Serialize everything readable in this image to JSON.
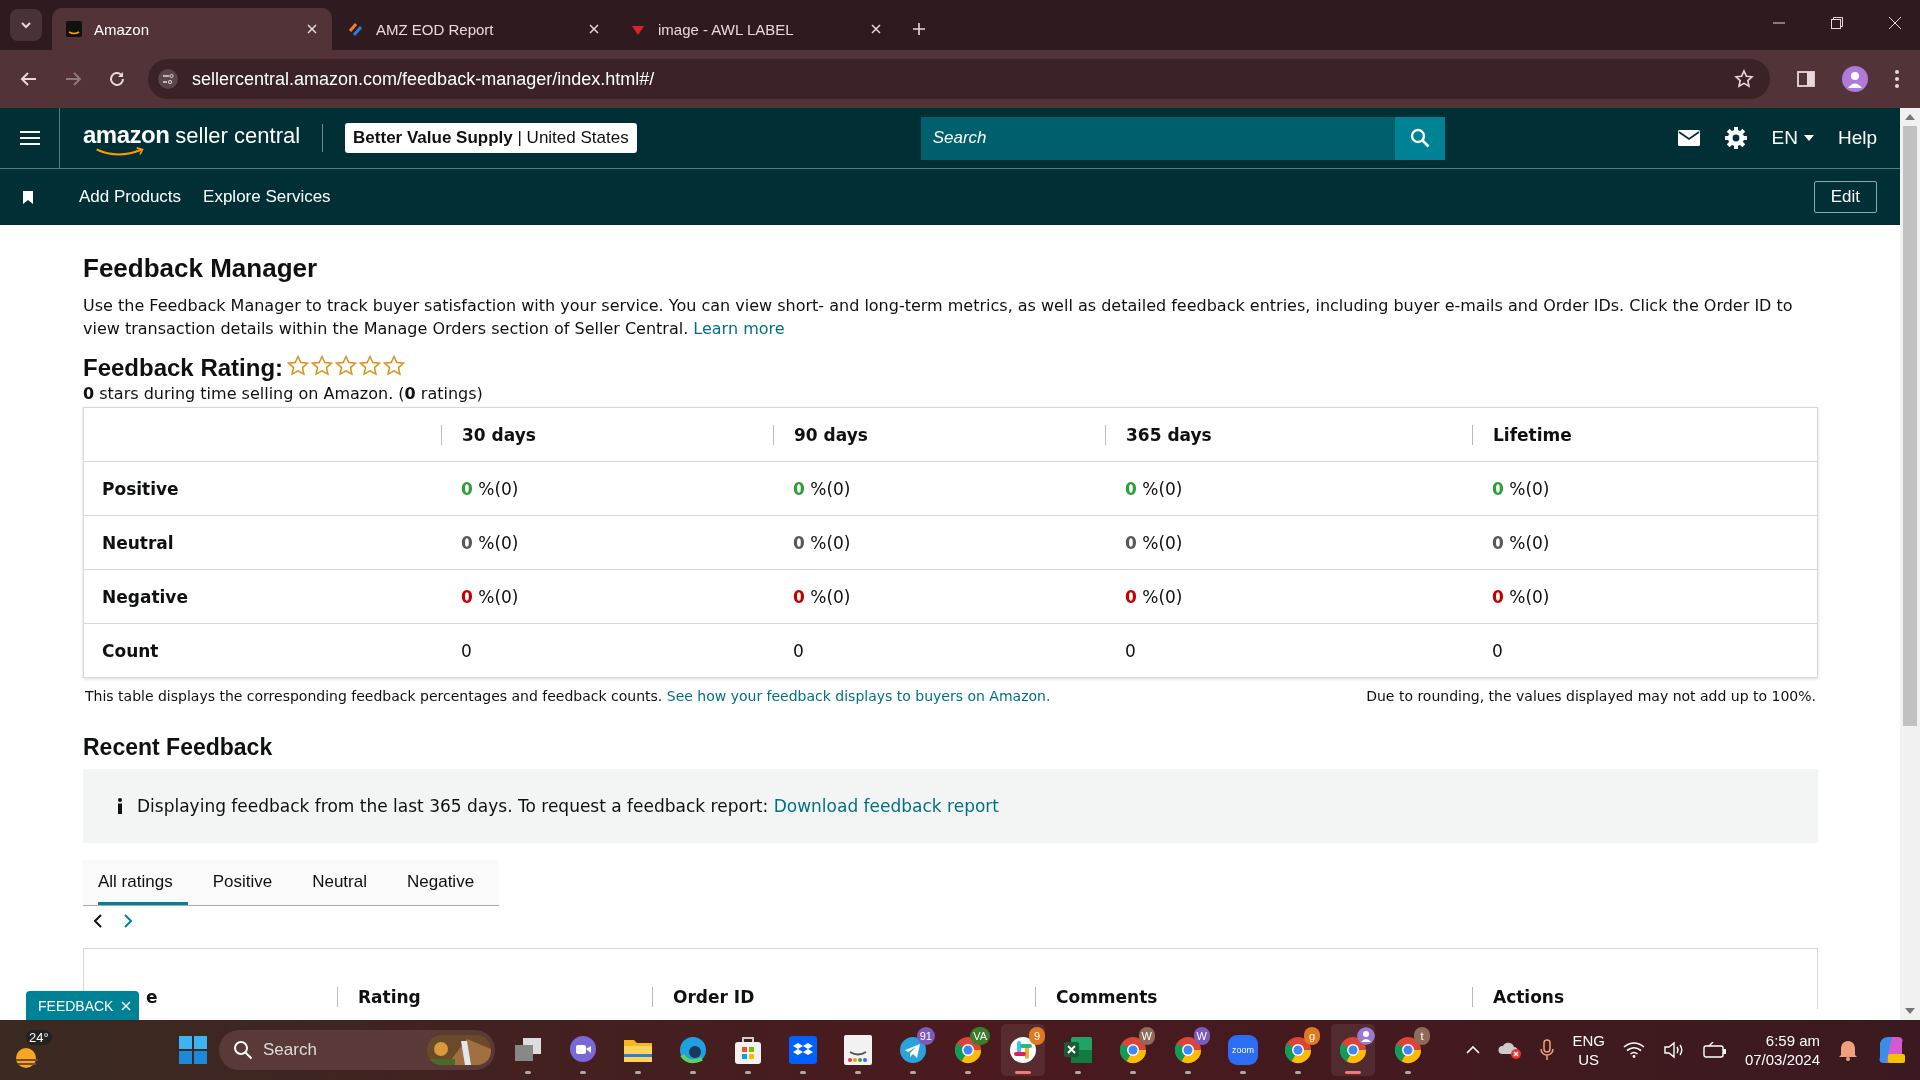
{
  "browser": {
    "tabs": [
      {
        "title": "Amazon",
        "kind": "amazon",
        "selected": true
      },
      {
        "title": "AMZ EOD Report",
        "kind": "report",
        "selected": false
      },
      {
        "title": "image - AWL LABEL",
        "selected": false
      }
    ],
    "url": "sellercentral.amazon.com/feedback-manager/index.html#/"
  },
  "header": {
    "logo_brand": "amazon",
    "logo_suffix": "seller central",
    "store": "Better Value Supply",
    "separator": "|",
    "region": "United States",
    "search": {
      "placeholder": "Search"
    },
    "language": "EN",
    "help": "Help"
  },
  "nav": {
    "links": [
      "Add Products",
      "Explore Services"
    ],
    "edit_button": "Edit"
  },
  "page": {
    "title": "Feedback Manager",
    "description": "Use the Feedback Manager to track buyer satisfaction with your service. You can view short- and long-term metrics, as well as detailed feedback entries, including buyer e-mails and Order IDs. Click the Order ID to view transaction details within the Manage Orders section of Seller Central.",
    "learn_more": "Learn more",
    "rating": {
      "label": "Feedback Rating:",
      "stars": 0,
      "summary": "**0** stars during time selling on Amazon. (**0** ratings)"
    }
  },
  "metrics_table": {
    "columns": [
      "30 days",
      "90 days",
      "365 days",
      "Lifetime"
    ],
    "rows": [
      {
        "label": "Positive",
        "kind": "positive",
        "cells": [
          {
            "value": "0",
            "unit": "%(0)"
          },
          {
            "value": "0",
            "unit": "%(0)"
          },
          {
            "value": "0",
            "unit": "%(0)"
          },
          {
            "value": "0",
            "unit": "%(0)"
          }
        ]
      },
      {
        "label": "Neutral",
        "kind": "neutral",
        "cells": [
          {
            "value": "0",
            "unit": "%(0)"
          },
          {
            "value": "0",
            "unit": "%(0)"
          },
          {
            "value": "0",
            "unit": "%(0)"
          },
          {
            "value": "0",
            "unit": "%(0)"
          }
        ]
      },
      {
        "label": "Negative",
        "kind": "negative",
        "cells": [
          {
            "value": "0",
            "unit": "%(0)"
          },
          {
            "value": "0",
            "unit": "%(0)"
          },
          {
            "value": "0",
            "unit": "%(0)"
          },
          {
            "value": "0",
            "unit": "%(0)"
          }
        ]
      },
      {
        "label": "Count",
        "kind": "count",
        "cells": [
          {
            "value": "0"
          },
          {
            "value": "0"
          },
          {
            "value": "0"
          },
          {
            "value": "0"
          }
        ]
      }
    ],
    "caption": "This table displays the corresponding feedback percentages and feedback counts.",
    "caption_link": "See how your feedback displays to buyers on Amazon.",
    "rounding_note": "Due to rounding, the values displayed may not add up to 100%."
  },
  "recent": {
    "title": "Recent Feedback",
    "notice": "Displaying feedback from the last 365 days. To request a feedback report:",
    "notice_link": "Download feedback report",
    "tabs": [
      {
        "label": "All ratings",
        "selected": true
      },
      {
        "label": "Positive",
        "selected": false
      },
      {
        "label": "Neutral",
        "selected": false
      },
      {
        "label": "Negative",
        "selected": false
      }
    ],
    "columns": [
      "e",
      "Rating",
      "Order ID",
      "Comments",
      "Actions"
    ]
  },
  "feedback_button": "FEEDBACK",
  "taskbar": {
    "weather": "24°",
    "search": "Search",
    "apps": [
      {
        "kind": "taskview",
        "active": false
      },
      {
        "kind": "meet",
        "active": false
      },
      {
        "kind": "folder",
        "active": false
      },
      {
        "kind": "edge",
        "active": false
      },
      {
        "kind": "store",
        "active": false
      },
      {
        "kind": "dropbox",
        "active": false
      },
      {
        "kind": "amazon",
        "active": false
      },
      {
        "kind": "telegram",
        "badge": "91",
        "active": false
      },
      {
        "kind": "chrome",
        "badge": "VA",
        "active": false
      },
      {
        "kind": "slack",
        "badge": "9",
        "active": true
      },
      {
        "kind": "excel",
        "active": false
      },
      {
        "kind": "chrome",
        "badge": "W",
        "active": false
      },
      {
        "kind": "chrome",
        "badge": "W",
        "active": false
      },
      {
        "kind": "zoom",
        "label": "zoom",
        "active": false
      },
      {
        "kind": "chrome",
        "badge": "g",
        "active": false
      },
      {
        "kind": "chrome",
        "avatar": true,
        "active": true
      },
      {
        "kind": "chrome",
        "badge": "t",
        "active": false
      }
    ],
    "language": "ENG",
    "region": "US",
    "time": "6:59 am",
    "date": "07/03/2024"
  }
}
